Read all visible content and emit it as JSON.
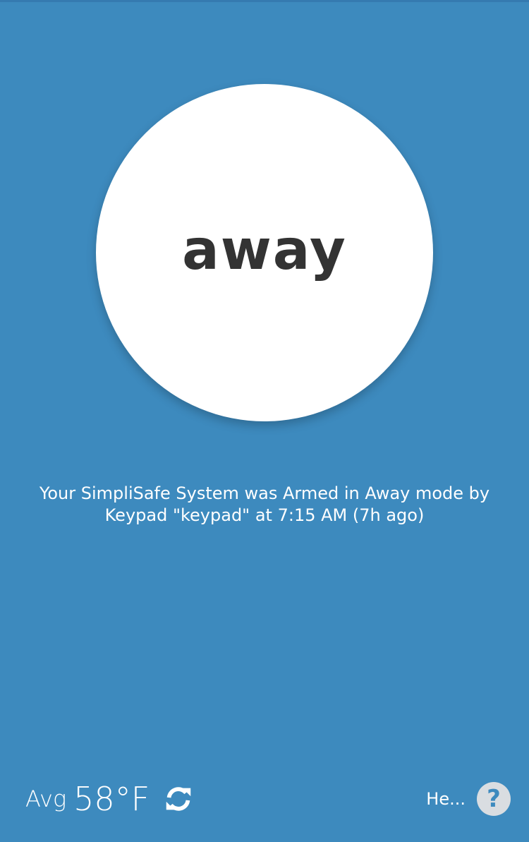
{
  "mode": {
    "label": "away"
  },
  "status": {
    "message": "Your SimpliSafe System was Armed in Away mode by Keypad \"keypad\" at 7:15 AM (7h ago)"
  },
  "temperature": {
    "prefix": "Avg",
    "value": "58°F",
    "refresh_icon": "refresh-icon"
  },
  "help": {
    "label": "He...",
    "icon": "question-circle-icon"
  },
  "colors": {
    "background": "#3d8abe",
    "circle": "#ffffff",
    "mode_text": "#333333",
    "help_icon_bg": "#d9dde1"
  }
}
